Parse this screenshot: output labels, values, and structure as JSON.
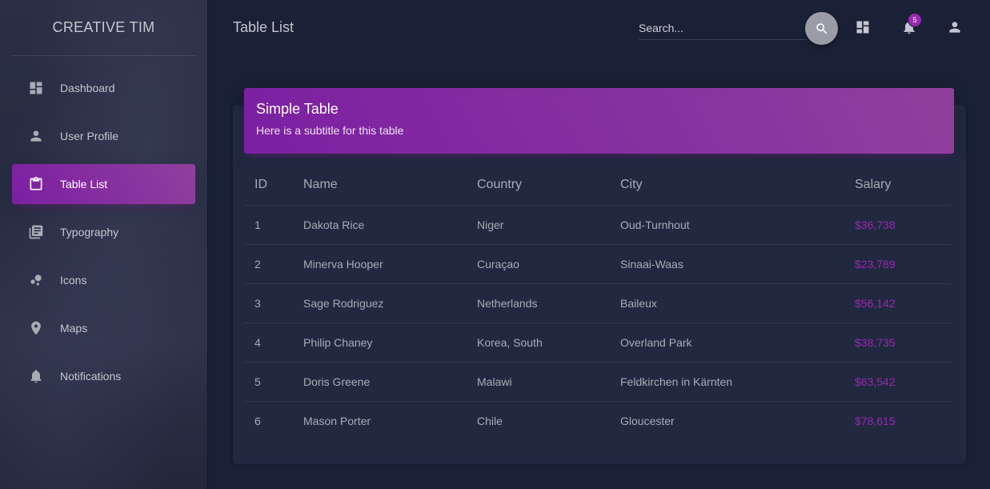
{
  "sidebar": {
    "brand": "CREATIVE TIM",
    "items": [
      {
        "label": "Dashboard",
        "icon": "dashboard-icon"
      },
      {
        "label": "User Profile",
        "icon": "person-icon"
      },
      {
        "label": "Table List",
        "icon": "clipboard-icon",
        "active": true
      },
      {
        "label": "Typography",
        "icon": "library-books-icon"
      },
      {
        "label": "Icons",
        "icon": "bubble-chart-icon"
      },
      {
        "label": "Maps",
        "icon": "location-pin-icon"
      },
      {
        "label": "Notifications",
        "icon": "bell-icon"
      }
    ]
  },
  "header": {
    "title": "Table List",
    "search": {
      "placeholder": "Search...",
      "value": ""
    },
    "notification_count": "5"
  },
  "card": {
    "title": "Simple Table",
    "subtitle": "Here is a subtitle for this table",
    "columns": [
      "ID",
      "Name",
      "Country",
      "City",
      "Salary"
    ],
    "rows": [
      [
        "1",
        "Dakota Rice",
        "Niger",
        "Oud-Turnhout",
        "$36,738"
      ],
      [
        "2",
        "Minerva Hooper",
        "Curaçao",
        "Sinaai-Waas",
        "$23,789"
      ],
      [
        "3",
        "Sage Rodriguez",
        "Netherlands",
        "Baileux",
        "$56,142"
      ],
      [
        "4",
        "Philip Chaney",
        "Korea, South",
        "Overland Park",
        "$38,735"
      ],
      [
        "5",
        "Doris Greene",
        "Malawi",
        "Feldkirchen in Kärnten",
        "$63,542"
      ],
      [
        "6",
        "Mason Porter",
        "Chile",
        "Gloucester",
        "$78,615"
      ]
    ]
  },
  "colors": {
    "accent": "#9c27b0",
    "background": "#1a2035",
    "card": "#202940"
  }
}
